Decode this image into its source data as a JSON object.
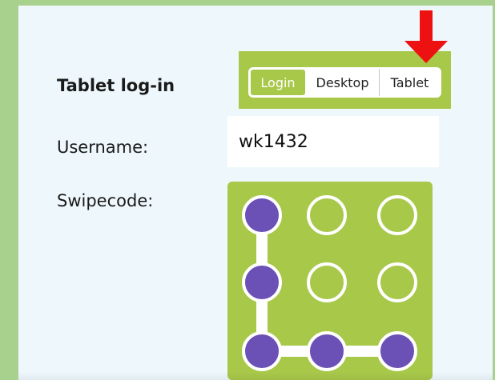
{
  "page": {
    "title": "Tablet log-in"
  },
  "tabs": {
    "items": [
      {
        "label": "Login",
        "selected": true
      },
      {
        "label": "Desktop",
        "selected": false
      },
      {
        "label": "Tablet",
        "selected": false
      }
    ]
  },
  "username": {
    "label": "Username:",
    "value": "wk1432"
  },
  "swipecode": {
    "label": "Swipecode:",
    "grid": {
      "rows": 3,
      "cols": 3
    },
    "selected_dots": [
      [
        0,
        0
      ],
      [
        1,
        0
      ],
      [
        2,
        0
      ],
      [
        2,
        1
      ],
      [
        2,
        2
      ]
    ]
  },
  "colors": {
    "background": "#a9d18e",
    "panel": "#eef8fc",
    "accent_green": "#a8c84a",
    "dot_selected": "#6b50b5",
    "arrow": "#ee1111"
  },
  "icons": {
    "pointer_arrow": "down-arrow-icon"
  }
}
